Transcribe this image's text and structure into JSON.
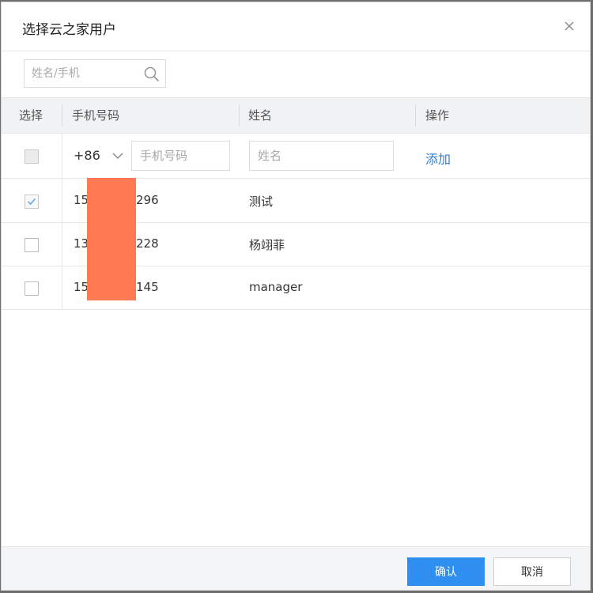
{
  "dialog": {
    "title": "选择云之家用户",
    "close_icon": "close-icon"
  },
  "search": {
    "placeholder": "姓名/手机",
    "icon": "search-icon"
  },
  "table": {
    "headers": [
      "选择",
      "手机号码",
      "姓名",
      "操作"
    ],
    "add_row": {
      "country_code": "+86",
      "phone_placeholder": "手机号码",
      "name_placeholder": "姓名",
      "action": "添加"
    },
    "rows": [
      {
        "phone_prefix": "15",
        "phone_suffix": "296",
        "name": "测试",
        "checked": true
      },
      {
        "phone_prefix": "13",
        "phone_suffix": "228",
        "name": "杨翊菲",
        "checked": false
      },
      {
        "phone_prefix": "15",
        "phone_suffix": "145",
        "name": "manager",
        "checked": false
      }
    ]
  },
  "footer": {
    "confirm": "确认",
    "cancel": "取消"
  },
  "colors": {
    "primary": "#2f8ff0",
    "link": "#2f7fd8",
    "redaction": "#ff7a52"
  }
}
